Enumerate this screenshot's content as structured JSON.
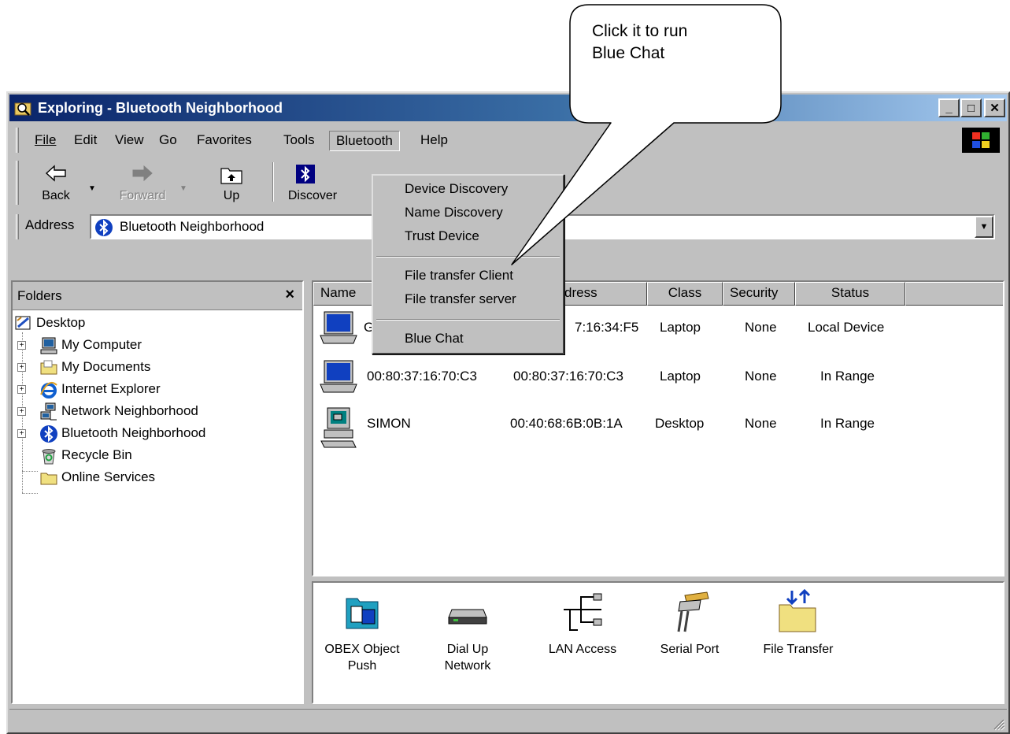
{
  "callout": {
    "line1": "Click it to run",
    "line2": "Blue Chat"
  },
  "window": {
    "title": "Exploring - Bluetooth Neighborhood",
    "minimize_glyph": "_",
    "maximize_glyph": "□",
    "close_glyph": "✕"
  },
  "menubar": {
    "file": "File",
    "edit": "Edit",
    "view": "View",
    "go": "Go",
    "favorites": "Favorites",
    "tools": "Tools",
    "bluetooth": "Bluetooth",
    "help": "Help"
  },
  "toolbar": {
    "back": "Back",
    "forward": "Forward",
    "up": "Up",
    "discover": "Discover"
  },
  "address": {
    "label": "Address",
    "value": "Bluetooth Neighborhood"
  },
  "folders": {
    "title": "Folders",
    "close_glyph": "×",
    "items": [
      {
        "label": "Desktop",
        "icon": "desktop-icon"
      },
      {
        "label": "My Computer",
        "icon": "computer-icon"
      },
      {
        "label": "My Documents",
        "icon": "folder-icon"
      },
      {
        "label": "Internet Explorer",
        "icon": "ie-icon"
      },
      {
        "label": "Network Neighborhood",
        "icon": "network-icon"
      },
      {
        "label": "Bluetooth Neighborhood",
        "icon": "bluetooth-icon"
      },
      {
        "label": "Recycle Bin",
        "icon": "recycle-bin-icon"
      },
      {
        "label": "Online Services",
        "icon": "folder-icon"
      }
    ]
  },
  "device_list": {
    "columns": [
      "Name",
      "dress",
      "Class",
      "Security",
      "Status"
    ],
    "rows": [
      {
        "name": "G",
        "address": "7:16:34:F5",
        "class": "Laptop",
        "security": "None",
        "status": "Local Device",
        "icon": "laptop-icon"
      },
      {
        "name": "00:80:37:16:70:C3",
        "address": "00:80:37:16:70:C3",
        "class": "Laptop",
        "security": "None",
        "status": "In Range",
        "icon": "laptop-icon"
      },
      {
        "name": "SIMON",
        "address": "00:40:68:6B:0B:1A",
        "class": "Desktop",
        "security": "None",
        "status": "In Range",
        "icon": "desktop-pc-icon"
      }
    ]
  },
  "services": [
    {
      "line1": "OBEX Object",
      "line2": "Push",
      "icon": "obex-push-icon"
    },
    {
      "line1": "Dial Up",
      "line2": "Network",
      "icon": "modem-icon"
    },
    {
      "line1": "LAN Access",
      "line2": "",
      "icon": "lan-access-icon"
    },
    {
      "line1": "Serial Port",
      "line2": "",
      "icon": "serial-port-icon"
    },
    {
      "line1": "File Transfer",
      "line2": "",
      "icon": "file-transfer-icon"
    }
  ],
  "bluetooth_menu": {
    "device_discovery": "Device Discovery",
    "name_discovery": "Name Discovery",
    "trust_device": "Trust Device",
    "file_transfer_client": "File transfer Client",
    "file_transfer_server": "File transfer server",
    "blue_chat": "Blue Chat"
  },
  "colors": {
    "title_start": "#0a246a",
    "title_end": "#a6caf0",
    "face": "#c0c0c0"
  }
}
